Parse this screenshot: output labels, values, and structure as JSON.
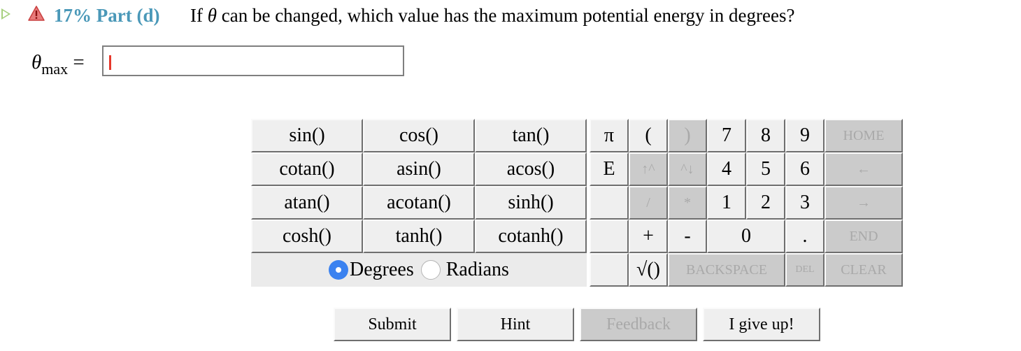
{
  "header": {
    "icons": [
      "play-icon",
      "warning-icon"
    ],
    "part_label": "17% Part (d)",
    "question_prefix": "If ",
    "question_symbol": "θ",
    "question_suffix": " can be changed, which value has the maximum potential energy in degrees?"
  },
  "answer": {
    "symbol": "θ",
    "subscript": "max",
    "equals": " =",
    "value": "",
    "colors": {
      "caret": "#e6382c",
      "part_label": "#4a98b8"
    }
  },
  "functions": [
    [
      "sin()",
      "cos()",
      "tan()"
    ],
    [
      "cotan()",
      "asin()",
      "acos()"
    ],
    [
      "atan()",
      "acotan()",
      "sinh()"
    ],
    [
      "cosh()",
      "tanh()",
      "cotanh()"
    ]
  ],
  "angle_mode": {
    "options": [
      {
        "label": "Degrees",
        "selected": true
      },
      {
        "label": "Radians",
        "selected": false
      }
    ]
  },
  "keys": {
    "pi": "π",
    "open_paren": "(",
    "close_paren": ")",
    "e": "E",
    "up_caret": "↑^",
    "caret_down": "^↓",
    "divide": "/",
    "multiply": "*",
    "plus": "+",
    "minus": "-",
    "sqrt": "√()",
    "digits": [
      "0",
      "1",
      "2",
      "3",
      "4",
      "5",
      "6",
      "7",
      "8",
      "9"
    ],
    "dot": ".",
    "home": "HOME",
    "left": "←",
    "right": "→",
    "end": "END",
    "backspace": "BACKSPACE",
    "del": "DEL",
    "clear": "CLEAR"
  },
  "actions": {
    "submit": "Submit",
    "hint": "Hint",
    "feedback": "Feedback",
    "give_up": "I give up!"
  }
}
